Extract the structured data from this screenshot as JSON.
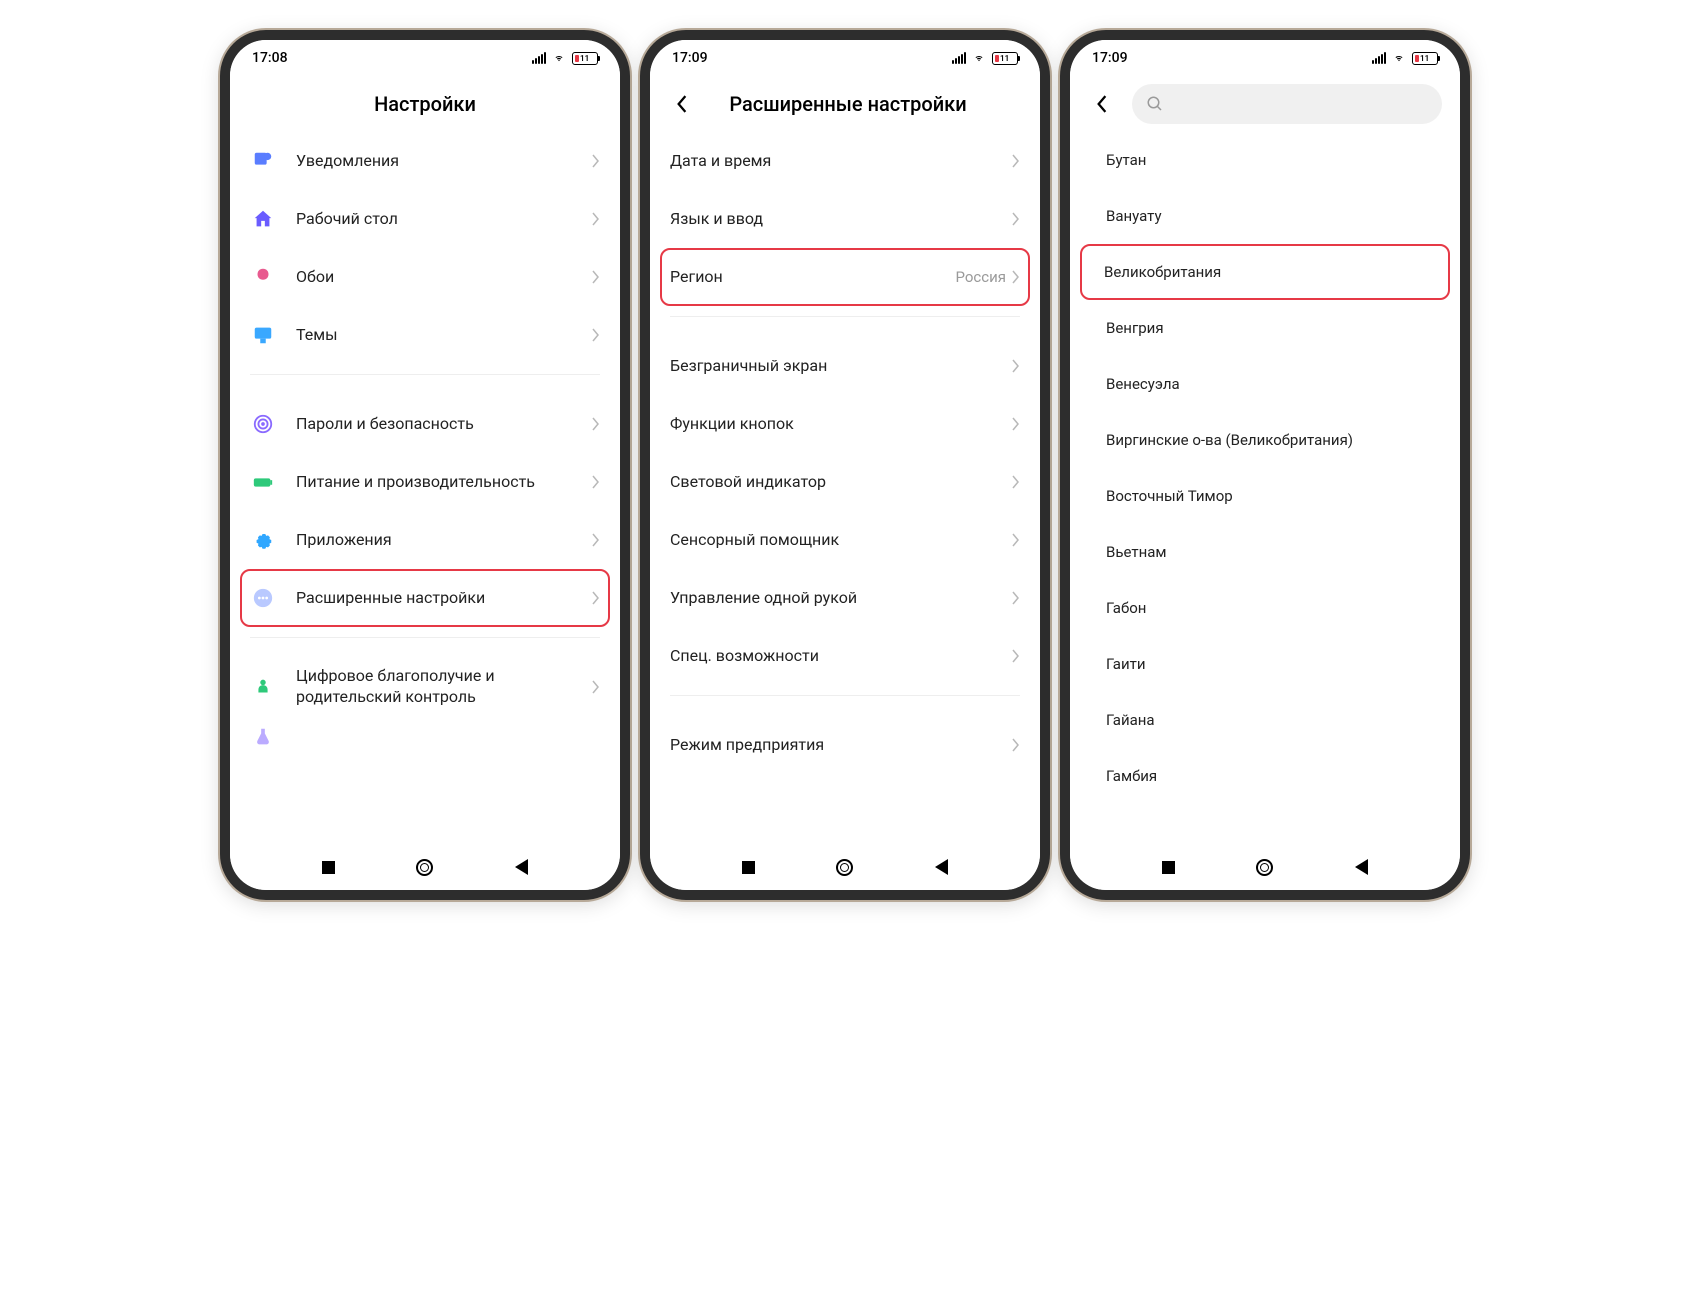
{
  "status": {
    "time1": "17:08",
    "time2": "17:09",
    "time3": "17:09",
    "batt": "11"
  },
  "screen1": {
    "title": "Настройки",
    "items": [
      {
        "label": "Уведомления"
      },
      {
        "label": "Рабочий стол"
      },
      {
        "label": "Обои"
      },
      {
        "label": "Темы"
      },
      {
        "label": "Пароли и безопасность"
      },
      {
        "label": "Питание и производительность"
      },
      {
        "label": "Приложения"
      },
      {
        "label": "Расширенные настройки"
      },
      {
        "label": "Цифровое благополучие и родительский контроль"
      }
    ]
  },
  "screen2": {
    "title": "Расширенные настройки",
    "region_value": "Россия",
    "items": [
      {
        "label": "Дата и время"
      },
      {
        "label": "Язык и ввод"
      },
      {
        "label": "Регион"
      },
      {
        "label": "Безграничный экран"
      },
      {
        "label": "Функции кнопок"
      },
      {
        "label": "Световой индикатор"
      },
      {
        "label": "Сенсорный помощник"
      },
      {
        "label": "Управление одной рукой"
      },
      {
        "label": "Спец. возможности"
      },
      {
        "label": "Режим предприятия"
      }
    ]
  },
  "screen3": {
    "countries": [
      "Бутан",
      "Вануату",
      "Великобритания",
      "Венгрия",
      "Венесуэла",
      "Виргинские о-ва (Великобритания)",
      "Восточный Тимор",
      "Вьетнам",
      "Габон",
      "Гаити",
      "Гайана",
      "Гамбия"
    ]
  }
}
